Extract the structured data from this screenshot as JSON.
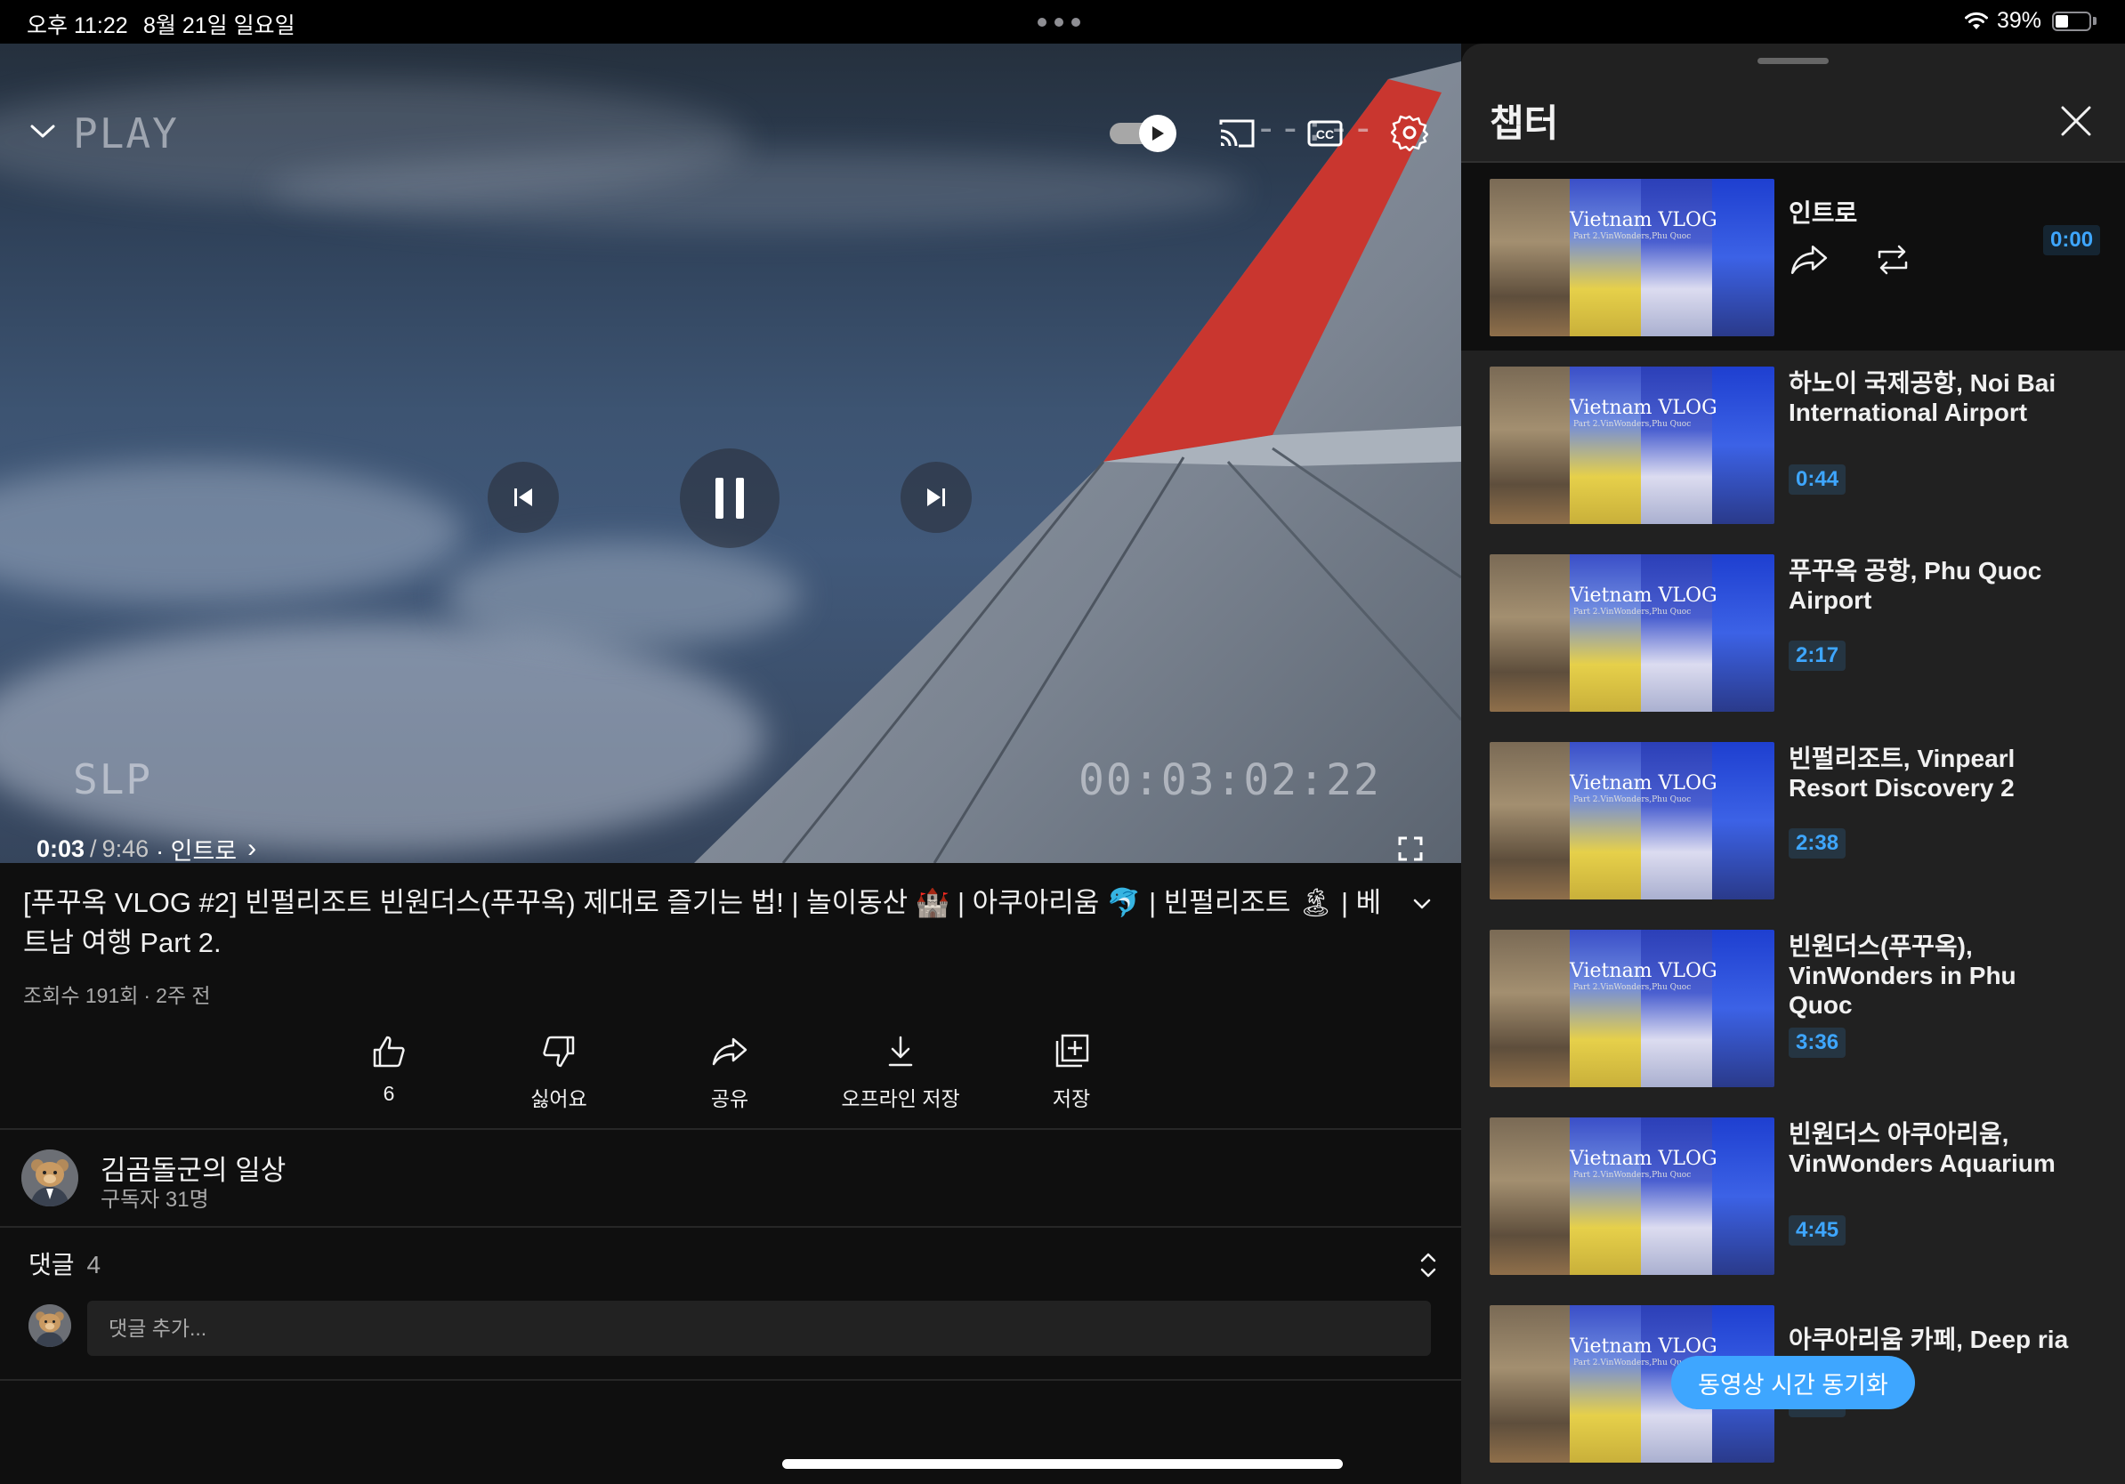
{
  "status_bar": {
    "time": "오후 11:22",
    "date": "8월 21일 일요일",
    "battery": "39%",
    "battery_level": 0.39
  },
  "player": {
    "watermark_play": "PLAY",
    "watermark_slp": "SLP",
    "watermark_timecode": "00:03:02:22",
    "watermark_dashes": "--:--",
    "current_time": "0:03",
    "separator": "/",
    "duration": "9:46",
    "chapter_label": "· 인트로",
    "chevron": "›",
    "progress_fraction": 0.0051,
    "autoplay_on": true,
    "accent_color": "#ff0000"
  },
  "video": {
    "title": "[푸꾸옥 VLOG #2] 빈펄리조트 빈원더스(푸꾸옥) 제대로 즐기는 법! | 놀이동산 🏰 | 아쿠아리움 🐬 | 빈펄리조트 🏝 | 베트남 여행 Part 2.",
    "views": "조회수 191회",
    "age": "2주 전",
    "meta_sep": "·"
  },
  "actions": [
    {
      "name": "like",
      "label": "6",
      "icon": "thumb-up-icon"
    },
    {
      "name": "dislike",
      "label": "싫어요",
      "icon": "thumb-down-icon"
    },
    {
      "name": "share",
      "label": "공유",
      "icon": "share-icon"
    },
    {
      "name": "download",
      "label": "오프라인 저장",
      "icon": "download-icon"
    },
    {
      "name": "save",
      "label": "저장",
      "icon": "add-to-playlist-icon"
    }
  ],
  "channel": {
    "name": "김곰돌군의 일상",
    "subscribers": "구독자 31명"
  },
  "comments": {
    "label": "댓글",
    "count": "4",
    "placeholder": "댓글 추가..."
  },
  "chapters_panel": {
    "title": "챕터",
    "thumb_caption": "Vietnam VLOG",
    "thumb_sub": "Part 2.VinWonders,Phu Quoc",
    "sync_button": "동영상 시간 동기화",
    "accent_color": "#3ea6ff",
    "items": [
      {
        "title": "인트로",
        "time": "0:00",
        "active": true
      },
      {
        "title": "하노이 국제공항, Noi Bai International Airport",
        "time": "0:44",
        "active": false
      },
      {
        "title": "푸꾸옥 공항, Phu Quoc Airport",
        "time": "2:17",
        "active": false
      },
      {
        "title": "빈펄리조트, Vinpearl Resort Discovery 2",
        "time": "2:38",
        "active": false
      },
      {
        "title": "빈원더스(푸꾸옥), VinWonders in Phu Quoc",
        "time": "3:36",
        "active": false
      },
      {
        "title": "빈원더스 아쿠아리움, VinWonders Aquarium",
        "time": "4:45",
        "active": false
      },
      {
        "title": "아쿠아리움 카페, Deep ria",
        "time": "6:18",
        "active": false
      }
    ]
  }
}
